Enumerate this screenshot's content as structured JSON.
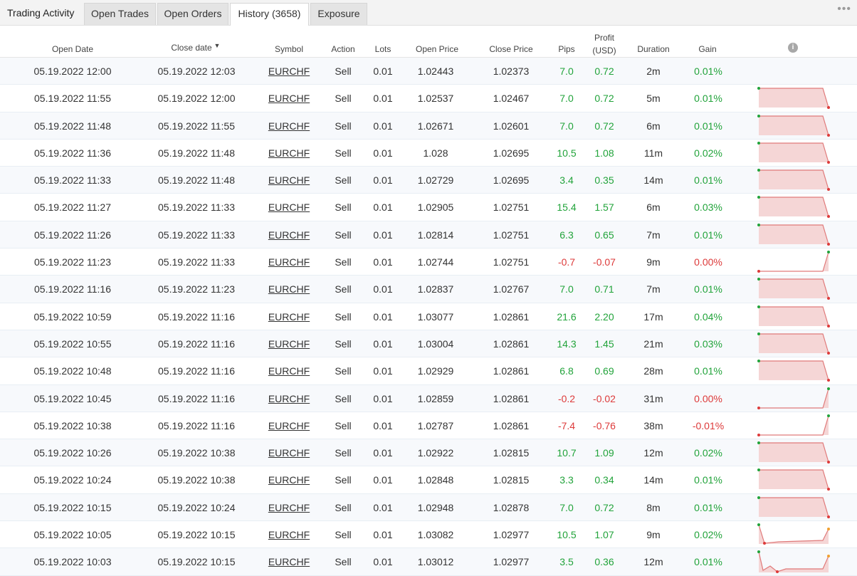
{
  "tabs": {
    "title": "Trading Activity",
    "items": [
      {
        "label": "Open Trades",
        "active": false
      },
      {
        "label": "Open Orders",
        "active": false
      },
      {
        "label": "History (3658)",
        "active": true
      },
      {
        "label": "Exposure",
        "active": false
      }
    ],
    "more_label": "•••"
  },
  "columns": {
    "open_date": "Open Date",
    "close_date": "Close date",
    "sort_indicator": "▼",
    "symbol": "Symbol",
    "action": "Action",
    "lots": "Lots",
    "open_price": "Open Price",
    "close_price": "Close Price",
    "pips": "Pips",
    "profit_top": "Profit",
    "profit_bottom": "(USD)",
    "duration": "Duration",
    "gain": "Gain",
    "info_icon": "i"
  },
  "colors": {
    "positive": "#21a33a",
    "negative": "#dd3a3a",
    "spark_line": "#e07a7a",
    "spark_fill": "#f5d6d6"
  },
  "rows": [
    {
      "open": "05.19.2022 12:00",
      "close": "05.19.2022 12:03",
      "symbol": "EURCHF",
      "action": "Sell",
      "lots": "0.01",
      "open_price": "1.02443",
      "close_price": "1.02373",
      "pips": "7.0",
      "profit": "0.72",
      "duration": "2m",
      "gain": "0.01%",
      "positive": true,
      "spark": "none"
    },
    {
      "open": "05.19.2022 11:55",
      "close": "05.19.2022 12:00",
      "symbol": "EURCHF",
      "action": "Sell",
      "lots": "0.01",
      "open_price": "1.02537",
      "close_price": "1.02467",
      "pips": "7.0",
      "profit": "0.72",
      "duration": "5m",
      "gain": "0.01%",
      "positive": true,
      "spark": "win"
    },
    {
      "open": "05.19.2022 11:48",
      "close": "05.19.2022 11:55",
      "symbol": "EURCHF",
      "action": "Sell",
      "lots": "0.01",
      "open_price": "1.02671",
      "close_price": "1.02601",
      "pips": "7.0",
      "profit": "0.72",
      "duration": "6m",
      "gain": "0.01%",
      "positive": true,
      "spark": "win"
    },
    {
      "open": "05.19.2022 11:36",
      "close": "05.19.2022 11:48",
      "symbol": "EURCHF",
      "action": "Sell",
      "lots": "0.01",
      "open_price": "1.028",
      "close_price": "1.02695",
      "pips": "10.5",
      "profit": "1.08",
      "duration": "11m",
      "gain": "0.02%",
      "positive": true,
      "spark": "win"
    },
    {
      "open": "05.19.2022 11:33",
      "close": "05.19.2022 11:48",
      "symbol": "EURCHF",
      "action": "Sell",
      "lots": "0.01",
      "open_price": "1.02729",
      "close_price": "1.02695",
      "pips": "3.4",
      "profit": "0.35",
      "duration": "14m",
      "gain": "0.01%",
      "positive": true,
      "spark": "win"
    },
    {
      "open": "05.19.2022 11:27",
      "close": "05.19.2022 11:33",
      "symbol": "EURCHF",
      "action": "Sell",
      "lots": "0.01",
      "open_price": "1.02905",
      "close_price": "1.02751",
      "pips": "15.4",
      "profit": "1.57",
      "duration": "6m",
      "gain": "0.03%",
      "positive": true,
      "spark": "win"
    },
    {
      "open": "05.19.2022 11:26",
      "close": "05.19.2022 11:33",
      "symbol": "EURCHF",
      "action": "Sell",
      "lots": "0.01",
      "open_price": "1.02814",
      "close_price": "1.02751",
      "pips": "6.3",
      "profit": "0.65",
      "duration": "7m",
      "gain": "0.01%",
      "positive": true,
      "spark": "win"
    },
    {
      "open": "05.19.2022 11:23",
      "close": "05.19.2022 11:33",
      "symbol": "EURCHF",
      "action": "Sell",
      "lots": "0.01",
      "open_price": "1.02744",
      "close_price": "1.02751",
      "pips": "-0.7",
      "profit": "-0.07",
      "duration": "9m",
      "gain": "0.00%",
      "positive": false,
      "spark": "loss"
    },
    {
      "open": "05.19.2022 11:16",
      "close": "05.19.2022 11:23",
      "symbol": "EURCHF",
      "action": "Sell",
      "lots": "0.01",
      "open_price": "1.02837",
      "close_price": "1.02767",
      "pips": "7.0",
      "profit": "0.71",
      "duration": "7m",
      "gain": "0.01%",
      "positive": true,
      "spark": "win"
    },
    {
      "open": "05.19.2022 10:59",
      "close": "05.19.2022 11:16",
      "symbol": "EURCHF",
      "action": "Sell",
      "lots": "0.01",
      "open_price": "1.03077",
      "close_price": "1.02861",
      "pips": "21.6",
      "profit": "2.20",
      "duration": "17m",
      "gain": "0.04%",
      "positive": true,
      "spark": "win"
    },
    {
      "open": "05.19.2022 10:55",
      "close": "05.19.2022 11:16",
      "symbol": "EURCHF",
      "action": "Sell",
      "lots": "0.01",
      "open_price": "1.03004",
      "close_price": "1.02861",
      "pips": "14.3",
      "profit": "1.45",
      "duration": "21m",
      "gain": "0.03%",
      "positive": true,
      "spark": "win"
    },
    {
      "open": "05.19.2022 10:48",
      "close": "05.19.2022 11:16",
      "symbol": "EURCHF",
      "action": "Sell",
      "lots": "0.01",
      "open_price": "1.02929",
      "close_price": "1.02861",
      "pips": "6.8",
      "profit": "0.69",
      "duration": "28m",
      "gain": "0.01%",
      "positive": true,
      "spark": "win"
    },
    {
      "open": "05.19.2022 10:45",
      "close": "05.19.2022 11:16",
      "symbol": "EURCHF",
      "action": "Sell",
      "lots": "0.01",
      "open_price": "1.02859",
      "close_price": "1.02861",
      "pips": "-0.2",
      "profit": "-0.02",
      "duration": "31m",
      "gain": "0.00%",
      "positive": false,
      "spark": "loss"
    },
    {
      "open": "05.19.2022 10:38",
      "close": "05.19.2022 11:16",
      "symbol": "EURCHF",
      "action": "Sell",
      "lots": "0.01",
      "open_price": "1.02787",
      "close_price": "1.02861",
      "pips": "-7.4",
      "profit": "-0.76",
      "duration": "38m",
      "gain": "-0.01%",
      "positive": false,
      "spark": "loss"
    },
    {
      "open": "05.19.2022 10:26",
      "close": "05.19.2022 10:38",
      "symbol": "EURCHF",
      "action": "Sell",
      "lots": "0.01",
      "open_price": "1.02922",
      "close_price": "1.02815",
      "pips": "10.7",
      "profit": "1.09",
      "duration": "12m",
      "gain": "0.02%",
      "positive": true,
      "spark": "win"
    },
    {
      "open": "05.19.2022 10:24",
      "close": "05.19.2022 10:38",
      "symbol": "EURCHF",
      "action": "Sell",
      "lots": "0.01",
      "open_price": "1.02848",
      "close_price": "1.02815",
      "pips": "3.3",
      "profit": "0.34",
      "duration": "14m",
      "gain": "0.01%",
      "positive": true,
      "spark": "win"
    },
    {
      "open": "05.19.2022 10:15",
      "close": "05.19.2022 10:24",
      "symbol": "EURCHF",
      "action": "Sell",
      "lots": "0.01",
      "open_price": "1.02948",
      "close_price": "1.02878",
      "pips": "7.0",
      "profit": "0.72",
      "duration": "8m",
      "gain": "0.01%",
      "positive": true,
      "spark": "win"
    },
    {
      "open": "05.19.2022 10:05",
      "close": "05.19.2022 10:15",
      "symbol": "EURCHF",
      "action": "Sell",
      "lots": "0.01",
      "open_price": "1.03082",
      "close_price": "1.02977",
      "pips": "10.5",
      "profit": "1.07",
      "duration": "9m",
      "gain": "0.02%",
      "positive": true,
      "spark": "wave"
    },
    {
      "open": "05.19.2022 10:03",
      "close": "05.19.2022 10:15",
      "symbol": "EURCHF",
      "action": "Sell",
      "lots": "0.01",
      "open_price": "1.03012",
      "close_price": "1.02977",
      "pips": "3.5",
      "profit": "0.36",
      "duration": "12m",
      "gain": "0.01%",
      "positive": true,
      "spark": "wave2"
    }
  ]
}
